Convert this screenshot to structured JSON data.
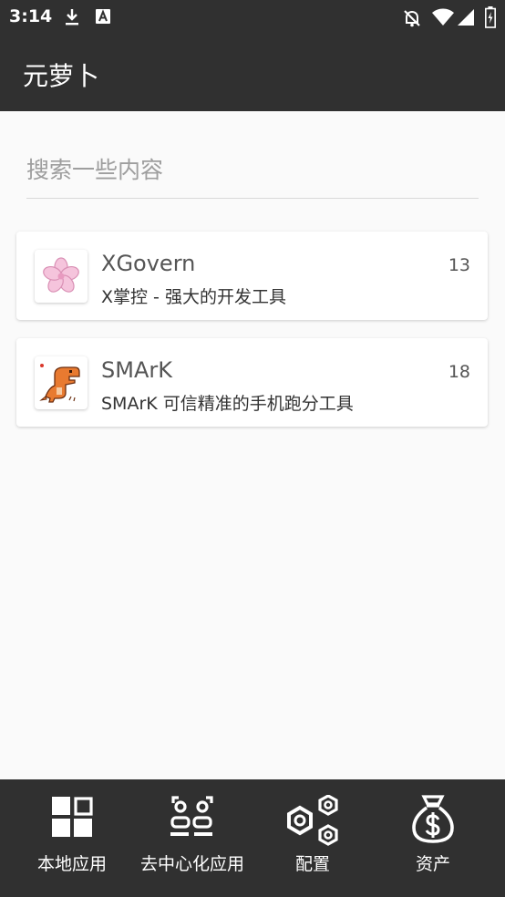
{
  "status_bar": {
    "time": "3:14",
    "icons": [
      "download-icon",
      "a-notification-icon",
      "notifications-off-icon",
      "wifi-icon",
      "cellular-signal-icon",
      "battery-icon"
    ]
  },
  "app_bar": {
    "title": "元萝卜"
  },
  "search": {
    "placeholder": "搜索一些内容",
    "value": ""
  },
  "apps": [
    {
      "name": "XGovern",
      "description": "X掌控 - 强大的开发工具",
      "count": "13",
      "icon": "sakura-flower-icon"
    },
    {
      "name": "SMArK",
      "description": "SMArK 可信精准的手机跑分工具",
      "count": "18",
      "icon": "dinosaur-icon"
    }
  ],
  "bottom_nav": [
    {
      "label": "本地应用",
      "icon": "grid-apps-icon"
    },
    {
      "label": "去中心化应用",
      "icon": "people-scan-icon"
    },
    {
      "label": "配置",
      "icon": "hexagon-nuts-icon"
    },
    {
      "label": "资产",
      "icon": "money-bag-icon"
    }
  ],
  "colors": {
    "bar_background": "#303030",
    "page_background": "#fafafa"
  }
}
